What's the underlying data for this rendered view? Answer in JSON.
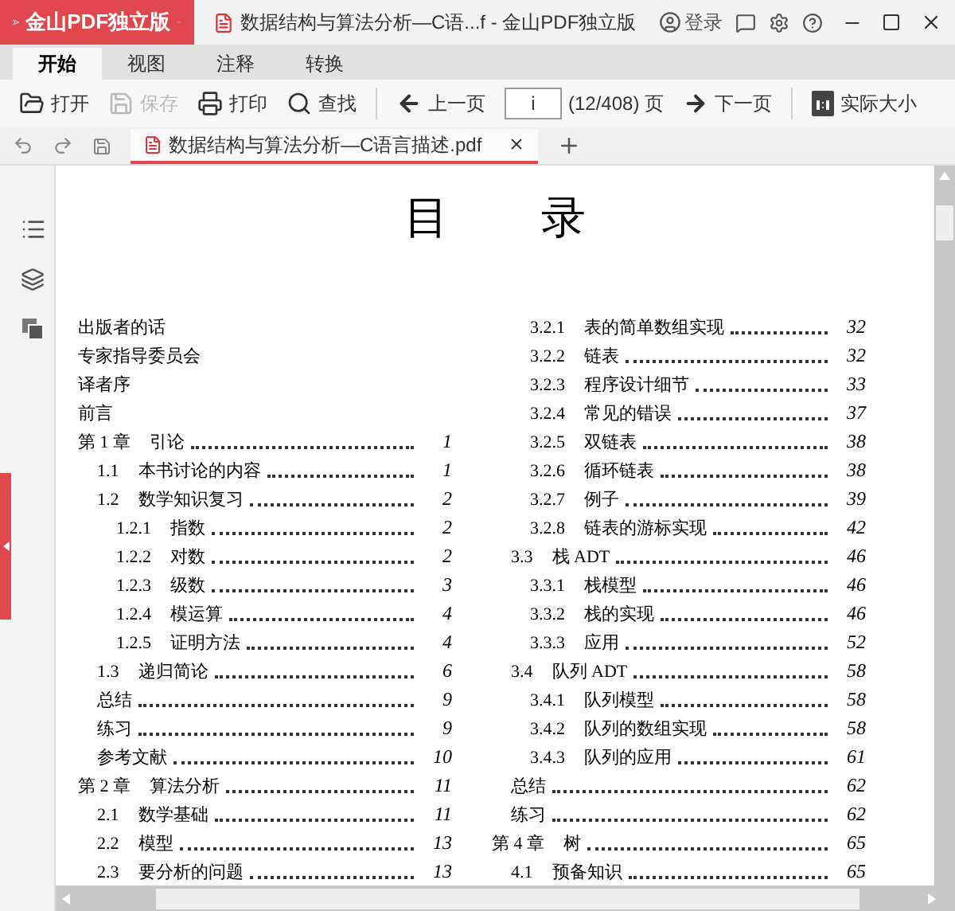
{
  "title_bar": {
    "app_menu": "金山PDF独立版",
    "document_title": "数据结构与算法分析—C语...f - 金山PDF独立版",
    "login": "登录"
  },
  "ribbon_tabs": [
    {
      "label": "开始",
      "selected": true
    },
    {
      "label": "视图",
      "selected": false
    },
    {
      "label": "注释",
      "selected": false
    },
    {
      "label": "转换",
      "selected": false
    }
  ],
  "toolbar": [
    {
      "kind": "open",
      "label": "打开",
      "disabled": false
    },
    {
      "kind": "save",
      "label": "保存",
      "disabled": true
    },
    {
      "kind": "print",
      "label": "打印",
      "disabled": false
    },
    {
      "kind": "find",
      "label": "查找",
      "disabled": false
    },
    {
      "kind": "prev",
      "label": "上一页",
      "disabled": false
    },
    {
      "kind": "page",
      "value": "i",
      "label": "(12/408) 页"
    },
    {
      "kind": "next",
      "label": "下一页",
      "disabled": false
    },
    {
      "kind": "actual_size",
      "label": "实际大小",
      "disabled": false
    }
  ],
  "document_tabs": [
    {
      "label": "数据结构与算法分析—C语言描述.pdf",
      "selected": true
    }
  ],
  "toc_title": [
    "目",
    "录"
  ],
  "toc_columns": [
    [
      {
        "title": "出版者的话"
      },
      {
        "title": "专家指导委员会"
      },
      {
        "title": "译者序"
      },
      {
        "title": "前言"
      },
      {
        "number": "第 1 章",
        "title": "引论",
        "page": "1",
        "children": [
          {
            "number": "1.1",
            "title": "本书讨论的内容",
            "page": "1"
          },
          {
            "number": "1.2",
            "title": "数学知识复习",
            "page": "2",
            "children": [
              {
                "number": "1.2.1",
                "title": "指数",
                "page": "2"
              },
              {
                "number": "1.2.2",
                "title": "对数",
                "page": "2"
              },
              {
                "number": "1.2.3",
                "title": "级数",
                "page": "3"
              },
              {
                "number": "1.2.4",
                "title": "模运算",
                "page": "4"
              },
              {
                "number": "1.2.5",
                "title": "证明方法",
                "page": "4"
              }
            ]
          },
          {
            "number": "1.3",
            "title": "递归简论",
            "page": "6"
          },
          {
            "title": "总结",
            "page": "9"
          },
          {
            "title": "练习",
            "page": "9"
          },
          {
            "title": "参考文献",
            "page": "10"
          }
        ]
      },
      {
        "number": "第 2 章",
        "title": "算法分析",
        "page": "11",
        "children": [
          {
            "number": "2.1",
            "title": "数学基础",
            "page": "11"
          },
          {
            "number": "2.2",
            "title": "模型",
            "page": "13"
          },
          {
            "number": "2.3",
            "title": "要分析的问题",
            "page": "13"
          }
        ]
      }
    ],
    [
      {
        "children": [
          {
            "children": [
              {
                "number": "3.2.1",
                "title": "表的简单数组实现",
                "page": "32"
              },
              {
                "number": "3.2.2",
                "title": "链表",
                "page": "32"
              },
              {
                "number": "3.2.3",
                "title": "程序设计细节",
                "page": "33"
              },
              {
                "number": "3.2.4",
                "title": "常见的错误",
                "page": "37"
              },
              {
                "number": "3.2.5",
                "title": "双链表",
                "page": "38"
              },
              {
                "number": "3.2.6",
                "title": "循环链表",
                "page": "38"
              },
              {
                "number": "3.2.7",
                "title": "例子",
                "page": "39"
              },
              {
                "number": "3.2.8",
                "title": "链表的游标实现",
                "page": "42"
              }
            ]
          },
          {
            "number": "3.3",
            "title": "栈 ADT",
            "page": "46",
            "children": [
              {
                "number": "3.3.1",
                "title": "栈模型",
                "page": "46"
              },
              {
                "number": "3.3.2",
                "title": "栈的实现",
                "page": "46"
              },
              {
                "number": "3.3.3",
                "title": "应用",
                "page": "52"
              }
            ]
          },
          {
            "number": "3.4",
            "title": "队列 ADT",
            "page": "58",
            "children": [
              {
                "number": "3.4.1",
                "title": "队列模型",
                "page": "58"
              },
              {
                "number": "3.4.2",
                "title": "队列的数组实现",
                "page": "58"
              },
              {
                "number": "3.4.3",
                "title": "队列的应用",
                "page": "61"
              }
            ]
          },
          {
            "title": "总结",
            "page": "62"
          },
          {
            "title": "练习",
            "page": "62"
          }
        ]
      },
      {
        "number": "第 4 章",
        "title": "树",
        "page": "65",
        "children": [
          {
            "number": "4.1",
            "title": "预备知识",
            "page": "65"
          }
        ]
      }
    ]
  ]
}
